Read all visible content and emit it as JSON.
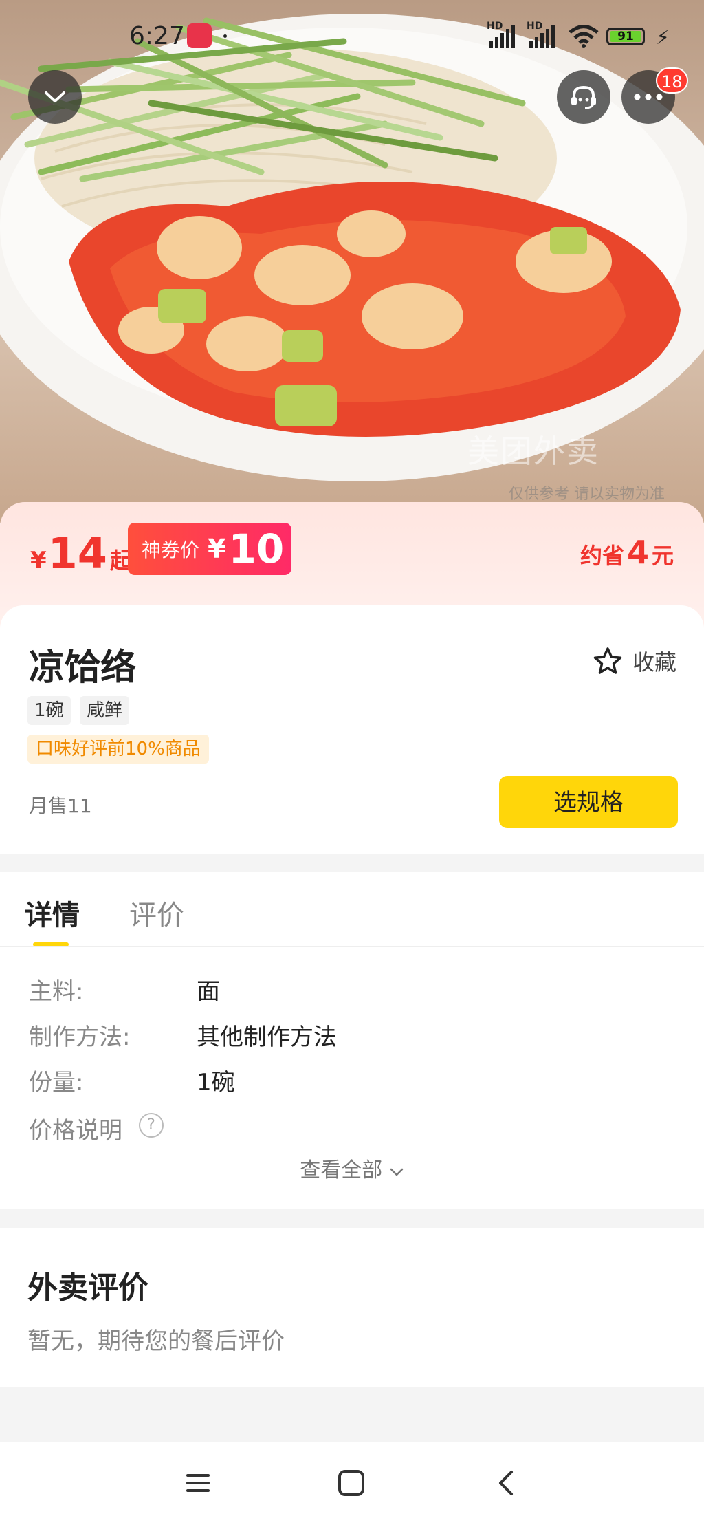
{
  "status_bar": {
    "time": "6:27",
    "hd_1": "HD",
    "hd_2": "HD",
    "battery": "91"
  },
  "header": {
    "message_badge": "18"
  },
  "hero": {
    "watermark": "美团外卖",
    "watermark_sub": "仅供参考 请以实物为准"
  },
  "price": {
    "currency": "¥",
    "from_price": "14",
    "from_suffix": "起",
    "coupon_label": "神券价",
    "coupon_currency": "¥",
    "coupon_price": "10",
    "save_prefix": "约省",
    "save_amount": "4",
    "save_suffix": "元"
  },
  "product": {
    "name": "凉饸络",
    "favorite_label": "收藏",
    "tags": [
      "1碗",
      "咸鲜"
    ],
    "rank_tag": "口味好评前10%商品",
    "monthly_sales": "月售11",
    "select_spec_label": "选规格"
  },
  "tabs": {
    "detail": "详情",
    "reviews": "评价"
  },
  "details": {
    "rows": [
      {
        "key": "主料:",
        "value": "面"
      },
      {
        "key": "制作方法:",
        "value": "其他制作方法"
      },
      {
        "key": "份量:",
        "value": "1碗"
      },
      {
        "key": "价格说明",
        "value": ""
      }
    ],
    "help_icon_text": "?",
    "view_all": "查看全部"
  },
  "reviews": {
    "title": "外卖评价",
    "empty_text": "暂无，期待您的餐后评价"
  },
  "colors": {
    "accent_red": "#f0352e",
    "accent_yellow": "#ffd60a",
    "badge_red": "#ff3b30"
  },
  "icons": {
    "back": "chevron-down-icon",
    "service": "customer-service-icon",
    "more": "more-dots-icon",
    "favorite": "star-outline-icon",
    "nav_menu": "menu-icon",
    "nav_home": "home-square-icon",
    "nav_back": "back-arrow-icon"
  }
}
